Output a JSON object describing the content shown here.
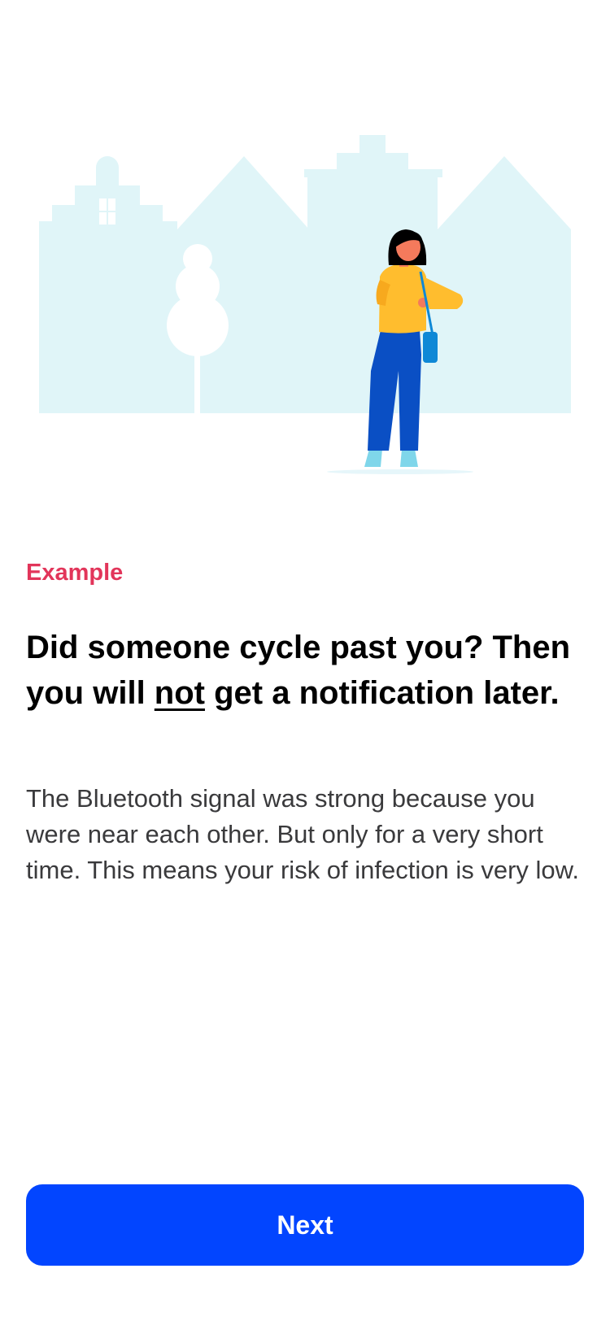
{
  "illustration": {
    "name": "person-checking-watch-in-town",
    "colors": {
      "buildings": "#e0f5f8",
      "tree": "#ffffff",
      "sweater": "#ffbd2e",
      "pants": "#0a4fc4",
      "bag": "#0f88d6",
      "shoes": "#7fd6ea",
      "skin": "#f47a5c",
      "hair": "#000000"
    }
  },
  "content": {
    "eyebrow": "Example",
    "title_part1": "Did someone cycle past you? Then you will ",
    "title_emphasis": "not",
    "title_part2": " get a notification later.",
    "body": "The Bluetooth signal was strong because you were near each other. But only for a very short time. This means your risk of infection is very low."
  },
  "footer": {
    "next_label": "Next"
  },
  "colors": {
    "accent_red": "#e2355a",
    "primary_blue": "#0245ff",
    "text_primary": "#000000",
    "text_secondary": "#3a3a3c"
  }
}
